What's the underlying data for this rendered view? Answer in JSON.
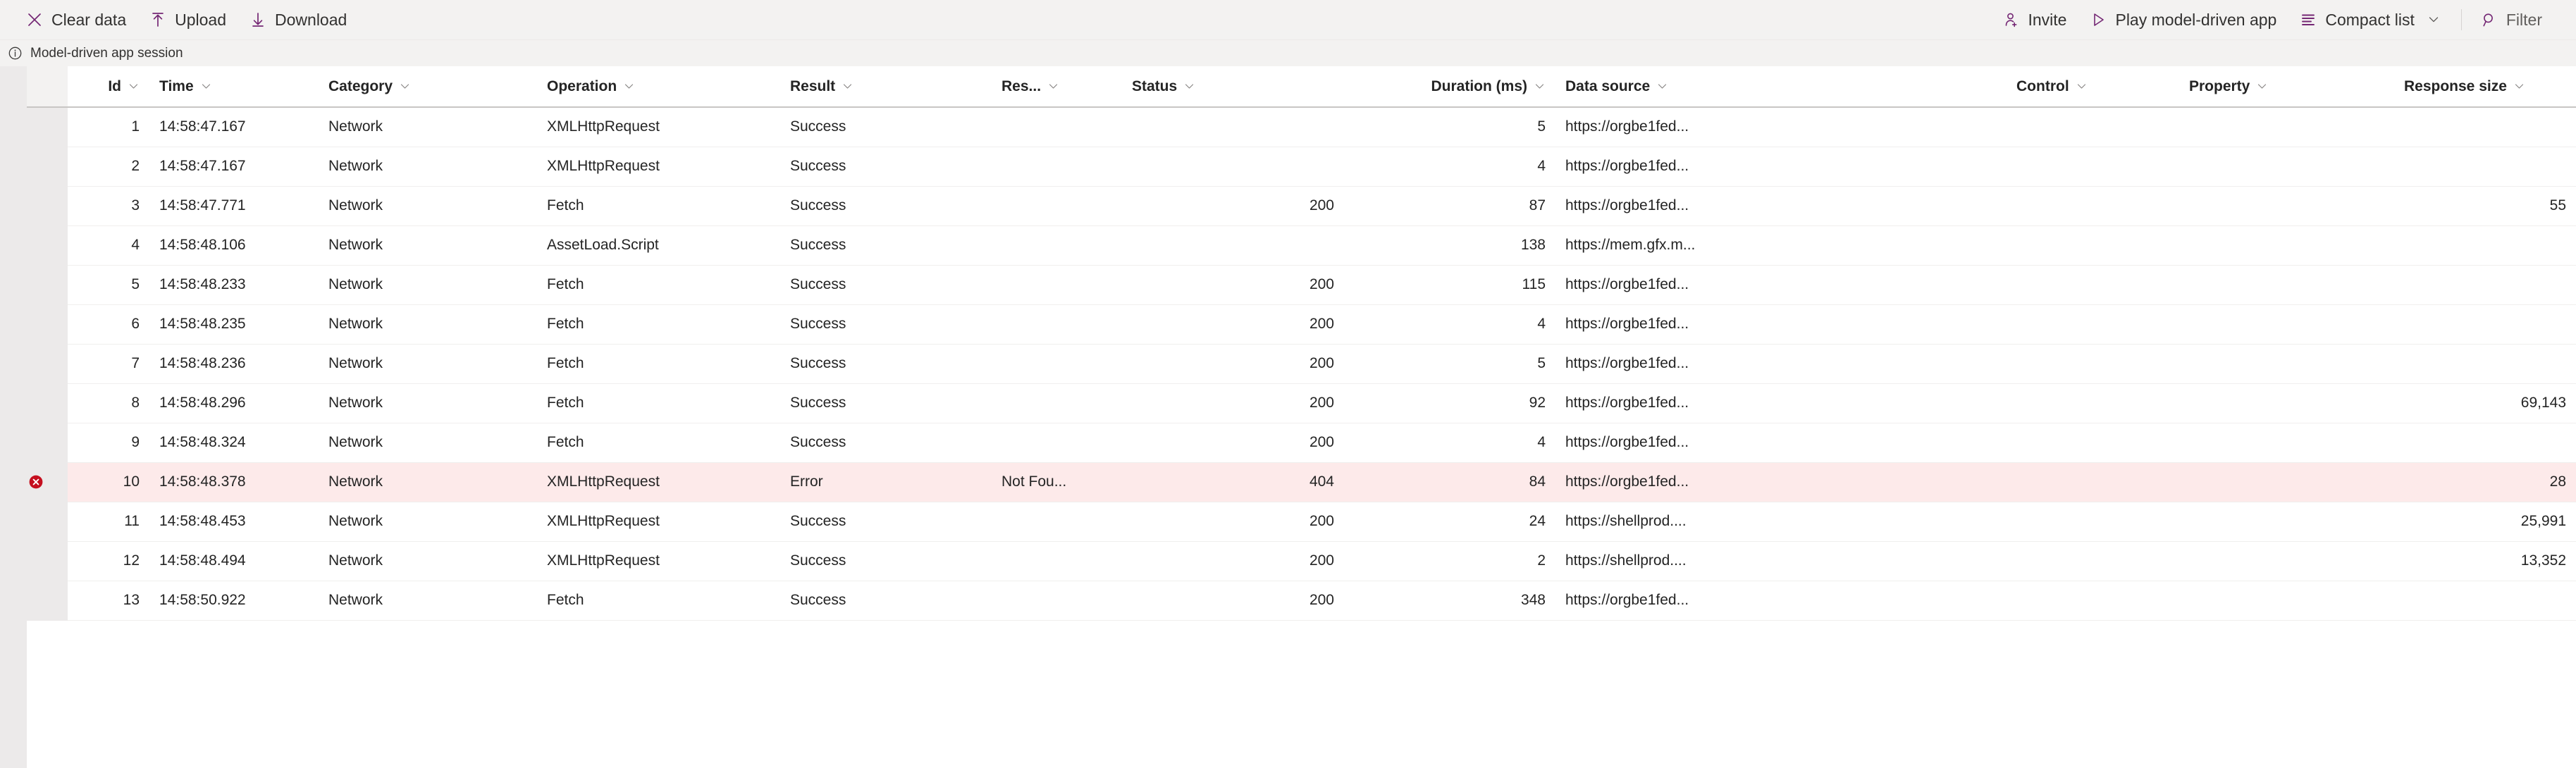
{
  "commandbar": {
    "left_items": [
      {
        "label": "Clear data",
        "icon": "clear-data-icon",
        "has_caret": false
      },
      {
        "label": "Upload",
        "icon": "upload-icon",
        "has_caret": false
      },
      {
        "label": "Download",
        "icon": "download-icon",
        "has_caret": false
      }
    ],
    "right_items": [
      {
        "label": "Invite",
        "icon": "invite-person-add-icon",
        "has_caret": false,
        "separator_before": false
      },
      {
        "label": "Play model-driven app",
        "icon": "play-icon",
        "has_caret": false,
        "separator_before": false
      },
      {
        "label": "Compact list",
        "icon": "compact-list-icon",
        "has_caret": true,
        "separator_before": false
      },
      {
        "label": "Filter",
        "icon": "filter-search-icon",
        "has_caret": false,
        "separator_before": true
      }
    ]
  },
  "infobar": {
    "icon": "info-circle-icon",
    "text": "Model-driven app session"
  },
  "colors": {
    "accent_purple": "#742774",
    "error_red": "#c50f1f",
    "error_row_bg": "#fdeaea",
    "chrome_gray": "#f3f2f1",
    "gutter_gray": "#eceaea"
  },
  "grid": {
    "columns": [
      {
        "key": "id",
        "label": "Id",
        "align": "right"
      },
      {
        "key": "time",
        "label": "Time",
        "align": "left"
      },
      {
        "key": "category",
        "label": "Category",
        "align": "left"
      },
      {
        "key": "operation",
        "label": "Operation",
        "align": "left"
      },
      {
        "key": "result",
        "label": "Result",
        "align": "left"
      },
      {
        "key": "res",
        "label": "Res...",
        "align": "left"
      },
      {
        "key": "status",
        "label": "Status",
        "align": "right"
      },
      {
        "key": "duration",
        "label": "Duration (ms)",
        "align": "right"
      },
      {
        "key": "source",
        "label": "Data source",
        "align": "left"
      },
      {
        "key": "control",
        "label": "Control",
        "align": "left"
      },
      {
        "key": "property",
        "label": "Property",
        "align": "left"
      },
      {
        "key": "size",
        "label": "Response size",
        "align": "right"
      }
    ],
    "rows": [
      {
        "state": "ok",
        "id": "1",
        "time": "14:58:47.167",
        "category": "Network",
        "operation": "XMLHttpRequest",
        "result": "Success",
        "res": "",
        "status": "",
        "duration": "5",
        "source": "https://orgbe1fed...",
        "control": "",
        "property": "",
        "size": ""
      },
      {
        "state": "ok",
        "id": "2",
        "time": "14:58:47.167",
        "category": "Network",
        "operation": "XMLHttpRequest",
        "result": "Success",
        "res": "",
        "status": "",
        "duration": "4",
        "source": "https://orgbe1fed...",
        "control": "",
        "property": "",
        "size": ""
      },
      {
        "state": "ok",
        "id": "3",
        "time": "14:58:47.771",
        "category": "Network",
        "operation": "Fetch",
        "result": "Success",
        "res": "",
        "status": "200",
        "duration": "87",
        "source": "https://orgbe1fed...",
        "control": "",
        "property": "",
        "size": "55"
      },
      {
        "state": "ok",
        "id": "4",
        "time": "14:58:48.106",
        "category": "Network",
        "operation": "AssetLoad.Script",
        "result": "Success",
        "res": "",
        "status": "",
        "duration": "138",
        "source": "https://mem.gfx.m...",
        "control": "",
        "property": "",
        "size": ""
      },
      {
        "state": "ok",
        "id": "5",
        "time": "14:58:48.233",
        "category": "Network",
        "operation": "Fetch",
        "result": "Success",
        "res": "",
        "status": "200",
        "duration": "115",
        "source": "https://orgbe1fed...",
        "control": "",
        "property": "",
        "size": ""
      },
      {
        "state": "ok",
        "id": "6",
        "time": "14:58:48.235",
        "category": "Network",
        "operation": "Fetch",
        "result": "Success",
        "res": "",
        "status": "200",
        "duration": "4",
        "source": "https://orgbe1fed...",
        "control": "",
        "property": "",
        "size": ""
      },
      {
        "state": "ok",
        "id": "7",
        "time": "14:58:48.236",
        "category": "Network",
        "operation": "Fetch",
        "result": "Success",
        "res": "",
        "status": "200",
        "duration": "5",
        "source": "https://orgbe1fed...",
        "control": "",
        "property": "",
        "size": ""
      },
      {
        "state": "ok",
        "id": "8",
        "time": "14:58:48.296",
        "category": "Network",
        "operation": "Fetch",
        "result": "Success",
        "res": "",
        "status": "200",
        "duration": "92",
        "source": "https://orgbe1fed...",
        "control": "",
        "property": "",
        "size": "69,143"
      },
      {
        "state": "ok",
        "id": "9",
        "time": "14:58:48.324",
        "category": "Network",
        "operation": "Fetch",
        "result": "Success",
        "res": "",
        "status": "200",
        "duration": "4",
        "source": "https://orgbe1fed...",
        "control": "",
        "property": "",
        "size": ""
      },
      {
        "state": "error",
        "id": "10",
        "time": "14:58:48.378",
        "category": "Network",
        "operation": "XMLHttpRequest",
        "result": "Error",
        "res": "Not Fou...",
        "status": "404",
        "duration": "84",
        "source": "https://orgbe1fed...",
        "control": "",
        "property": "",
        "size": "28"
      },
      {
        "state": "ok",
        "id": "11",
        "time": "14:58:48.453",
        "category": "Network",
        "operation": "XMLHttpRequest",
        "result": "Success",
        "res": "",
        "status": "200",
        "duration": "24",
        "source": "https://shellprod....",
        "control": "",
        "property": "",
        "size": "25,991"
      },
      {
        "state": "ok",
        "id": "12",
        "time": "14:58:48.494",
        "category": "Network",
        "operation": "XMLHttpRequest",
        "result": "Success",
        "res": "",
        "status": "200",
        "duration": "2",
        "source": "https://shellprod....",
        "control": "",
        "property": "",
        "size": "13,352"
      },
      {
        "state": "ok",
        "id": "13",
        "time": "14:58:50.922",
        "category": "Network",
        "operation": "Fetch",
        "result": "Success",
        "res": "",
        "status": "200",
        "duration": "348",
        "source": "https://orgbe1fed...",
        "control": "",
        "property": "",
        "size": ""
      }
    ]
  }
}
